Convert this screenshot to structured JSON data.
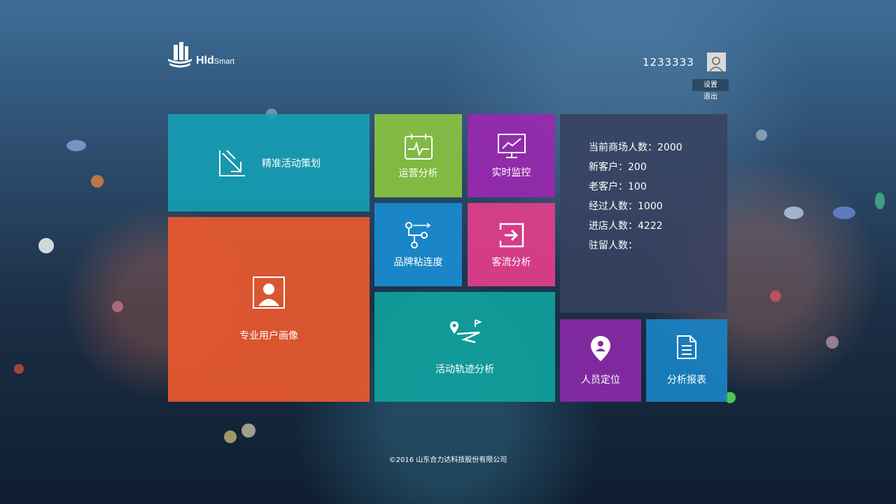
{
  "header": {
    "logo_main": "Hld",
    "logo_sub": "Smart"
  },
  "user": {
    "name": "1233333",
    "menu": [
      "设置",
      "退出"
    ]
  },
  "tiles": [
    {
      "label": "精准活动策划",
      "icon": "chart-arrow-icon",
      "color": "#15a0b5"
    },
    {
      "label": "运营分析",
      "icon": "calendar-pulse-icon",
      "color": "#8bc53f"
    },
    {
      "label": "实时监控",
      "icon": "monitor-chart-icon",
      "color": "#9b27b0"
    },
    {
      "label": "专业用户画像",
      "icon": "user-portrait-icon",
      "color": "#ee5a2d"
    },
    {
      "label": "品牌粘连度",
      "icon": "network-icon",
      "color": "#1a8ed4"
    },
    {
      "label": "客流分析",
      "icon": "enter-icon",
      "color": "#e83e8c"
    },
    {
      "label": "活动轨迹分析",
      "icon": "route-map-icon",
      "color": "#0fa39e"
    },
    {
      "label": "人员定位",
      "icon": "location-pin-icon",
      "color": "#8a2aa8"
    },
    {
      "label": "分析报表",
      "icon": "document-icon",
      "color": "#1a85c8"
    }
  ],
  "stats": [
    "当前商场人数：2000",
    "新客户：200",
    "老客户：100",
    "经过人数：1000",
    "进店人数：4222",
    "驻留人数："
  ],
  "footer": {
    "copyright": "©2016 山东合力达科技股份有限公司"
  }
}
